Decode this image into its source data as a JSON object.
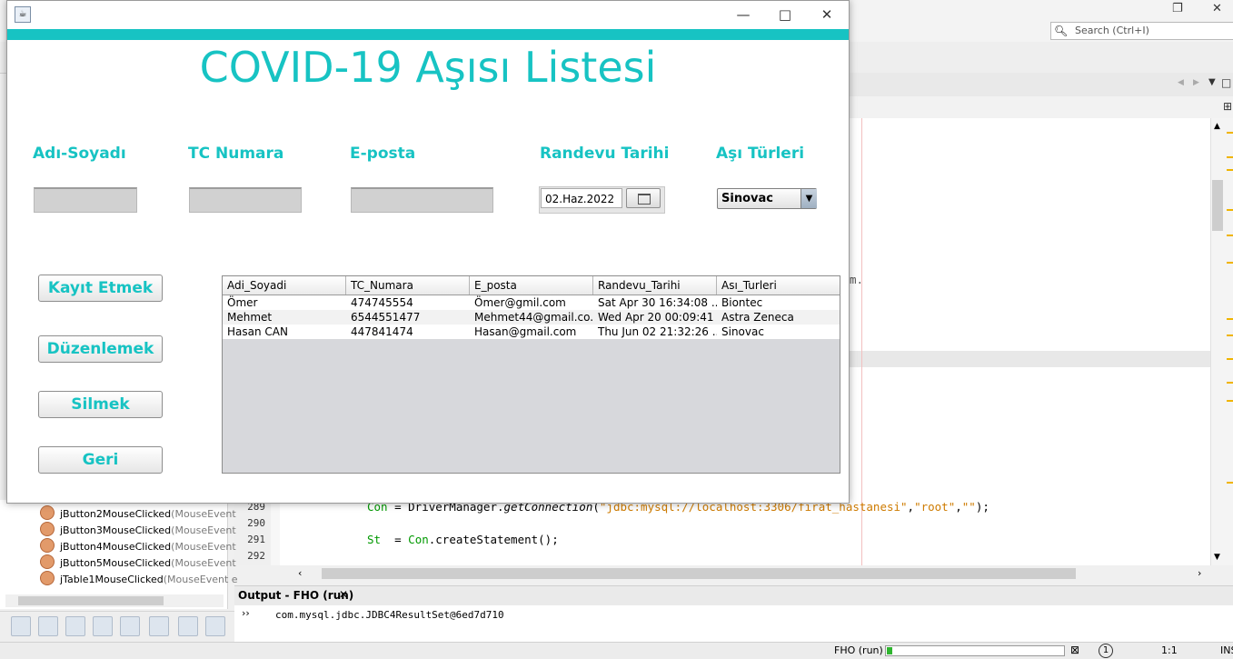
{
  "ide": {
    "search_placeholder": "Search (Ctrl+I)",
    "code_lines": [
      {
        "num": "289",
        "var": "Con",
        "rest_a": " = DriverManager.",
        "method": "getConnection",
        "rest_b": "(",
        "str1": "\"jdbc:mysql://localhost:3306/firat_hastanesi\"",
        "c1": ",",
        "str2": "\"root\"",
        "c2": ",",
        "str3": "\"\"",
        "end": ");"
      },
      {
        "num": "290"
      },
      {
        "num": "291",
        "var": "St",
        "rest_a": "  = ",
        "var2": "Con",
        "rest_b": ".createStatement();"
      },
      {
        "num": "292"
      }
    ],
    "tree_items": [
      {
        "name": "jButton2MouseClicked",
        "sig": "(MouseEvent"
      },
      {
        "name": "jButton3MouseClicked",
        "sig": "(MouseEvent"
      },
      {
        "name": "jButton4MouseClicked",
        "sig": "(MouseEvent"
      },
      {
        "name": "jButton5MouseClicked",
        "sig": "(MouseEvent"
      },
      {
        "name": "jTable1MouseClicked",
        "sig": "(MouseEvent e"
      }
    ],
    "output_tab_label": "Output - FHO (run)",
    "output_text": "com.mysql.jdbc.JDBC4ResultSet@6ed7d710",
    "status_run": "FHO (run)",
    "status_pos": "1:1",
    "status_mode": "INS",
    "status_badge": "1",
    "snippet_m": "m."
  },
  "app": {
    "title": "COVID-19 Aşısı Listesi",
    "accent_color": "#17c3c3",
    "labels": {
      "name": "Adı-Soyadı",
      "tc": "TC Numara",
      "email": "E-posta",
      "date": "Randevu Tarihi",
      "vaccine": "Aşı Türleri"
    },
    "date_value": "02.Haz.2022",
    "vaccine_selected": "Sinovac",
    "buttons": {
      "save": "Kayıt Etmek",
      "edit": "Düzenlemek",
      "delete": "Silmek",
      "back": "Geri"
    },
    "table": {
      "columns": [
        "Adi_Soyadi",
        "TC_Numara",
        "E_posta",
        "Randevu_Tarihi",
        "Ası_Turleri"
      ],
      "rows": [
        [
          "Ömer",
          "474745554",
          "Ömer@gmil.com",
          "Sat Apr 30 16:34:08 ...",
          "Biontec"
        ],
        [
          "Mehmet",
          "6544551477",
          "Mehmet44@gmail.co...",
          "Wed Apr 20 00:09:41 ...",
          "Astra Zeneca"
        ],
        [
          "Hasan CAN",
          "447841474",
          "Hasan@gmail.com",
          "Thu Jun 02 21:32:26 ...",
          "Sinovac"
        ]
      ]
    }
  }
}
